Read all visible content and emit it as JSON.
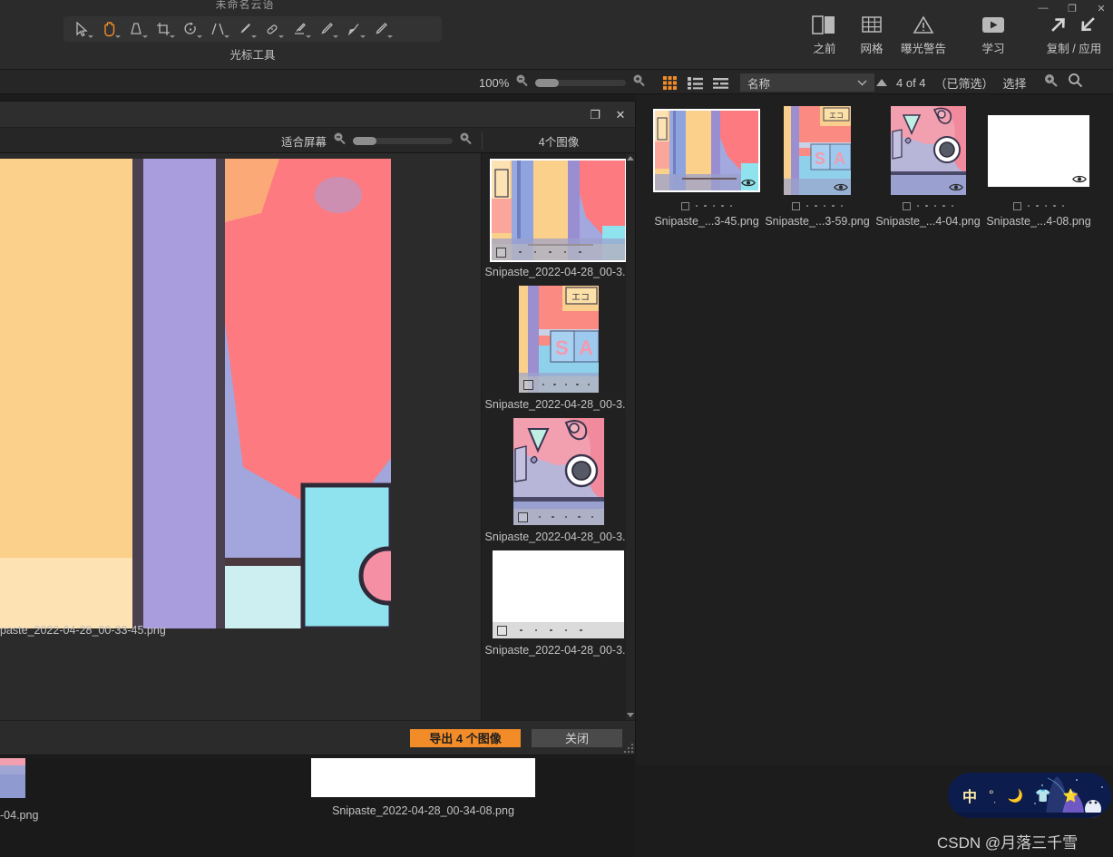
{
  "app": {
    "title": "未命名云语",
    "window_controls": [
      "minimize-icon",
      "restore-icon",
      "close-icon"
    ],
    "tool_label": "光标工具",
    "tools": [
      {
        "name": "select-tool",
        "icon": "cursor-arrow-icon",
        "active": false
      },
      {
        "name": "hand-tool",
        "icon": "hand-icon",
        "active": true
      },
      {
        "name": "white-balance-tool",
        "icon": "eyedropper-balance-icon",
        "active": false
      },
      {
        "name": "crop-tool",
        "icon": "crop-icon",
        "active": false
      },
      {
        "name": "rotate-tool",
        "icon": "rotate-icon",
        "active": false
      },
      {
        "name": "perspective-tool",
        "icon": "perspective-icon",
        "active": false
      },
      {
        "name": "retouch-tool",
        "icon": "brush-icon",
        "active": false
      },
      {
        "name": "heal-tool",
        "icon": "bandage-icon",
        "active": false
      },
      {
        "name": "eraser-tool",
        "icon": "eraser-icon",
        "active": false
      },
      {
        "name": "dodge-tool",
        "icon": "pen-light-icon",
        "active": false
      },
      {
        "name": "burn-tool",
        "icon": "pen-dark-icon",
        "active": false
      },
      {
        "name": "pencil-tool",
        "icon": "pencil-icon",
        "active": false
      }
    ],
    "top_right": [
      {
        "name": "before-after",
        "icon": "before-after-icon",
        "label": "之前",
        "has_caret": true
      },
      {
        "name": "grid-overlay",
        "icon": "grid-icon",
        "label": "网格",
        "has_caret": false
      },
      {
        "name": "exposure-warning",
        "icon": "warning-triangle-icon",
        "label": "曝光警告",
        "has_caret": false
      },
      {
        "name": "learn",
        "icon": "play-video-icon",
        "label": "学习",
        "has_caret": false
      },
      {
        "name": "copy-apply",
        "icon": "arrow-out-in-icon",
        "label": "复制 / 应用",
        "has_caret": false
      }
    ]
  },
  "filterbar": {
    "zoom_percent": "100%",
    "zoom_out_icon": "magnifier-minus-icon",
    "zoom_in_icon": "magnifier-plus-icon",
    "view_modes": [
      {
        "name": "grid-view",
        "icon": "grid-view-icon",
        "active": true
      },
      {
        "name": "list-view",
        "icon": "list-view-icon",
        "active": false
      },
      {
        "name": "detail-view",
        "icon": "detail-view-icon",
        "active": false
      }
    ],
    "sort_value": "名称",
    "sort_caret_icon": "chevron-down-icon",
    "sort_direction_icon": "triangle-up-icon",
    "count_text": "4 of 4",
    "filtered_text": "（已筛选）",
    "select_label": "选择",
    "filter_icon": "magnifier-plus-icon",
    "search_icon": "search-icon"
  },
  "grid": {
    "items": [
      {
        "name": "Snipaste_...3-45.png",
        "selected": true,
        "eye_icon": "eye-icon",
        "dots": 5,
        "thumb": "street-yellow-purple"
      },
      {
        "name": "Snipaste_...3-59.png",
        "selected": false,
        "eye_icon": "eye-icon",
        "dots": 5,
        "thumb": "sign-sa"
      },
      {
        "name": "Snipaste_...4-04.png",
        "selected": false,
        "eye_icon": "eye-icon",
        "dots": 5,
        "thumb": "pink-camera"
      },
      {
        "name": "Snipaste_...4-08.png",
        "selected": false,
        "eye_icon": "eye-icon",
        "dots": 5,
        "thumb": "blank-white"
      }
    ]
  },
  "filmstrip": {
    "items": [
      {
        "name": "-04.png",
        "thumb": "pink-camera"
      },
      {
        "name": "Snipaste_2022-04-28_00-34-08.png",
        "thumb": "blank-white"
      }
    ]
  },
  "dialog": {
    "window_controls": [
      "restore-icon",
      "close-icon"
    ],
    "fit_label": "适合屏幕",
    "zoom_out_icon": "magnifier-minus-icon",
    "zoom_in_icon": "magnifier-plus-icon",
    "image_count_label": "4个图像",
    "preview_caption": "paste_2022-04-28_00-33-45.png",
    "thumbnails": [
      {
        "name": "Snipaste_2022-04-28_00-3...",
        "selected": true,
        "dots": 5,
        "thumb": "street-yellow-purple"
      },
      {
        "name": "Snipaste_2022-04-28_00-3...",
        "selected": false,
        "dots": 5,
        "thumb": "sign-sa"
      },
      {
        "name": "Snipaste_2022-04-28_00-3...",
        "selected": false,
        "dots": 5,
        "thumb": "pink-camera"
      },
      {
        "name": "Snipaste_2022-04-28_00-3...",
        "selected": false,
        "dots": 5,
        "thumb": "blank-white"
      }
    ],
    "export_button": "导出 4 个图像",
    "close_button": "关闭"
  },
  "ime": {
    "lang": "中",
    "icons": [
      "degree-icon",
      "moon-icon",
      "shirt-icon",
      "star-icon"
    ]
  },
  "watermark": "CSDN @月落三千雪",
  "colors": {
    "accent_orange": "#f28c28",
    "panel_bg": "#2b2b2b",
    "app_bg": "#1f1f1f",
    "text": "#c9c9c9"
  }
}
